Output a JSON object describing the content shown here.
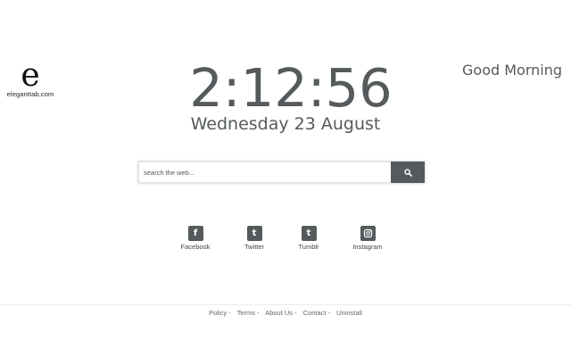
{
  "logo": {
    "mark": "e",
    "text": "eleganttab.com"
  },
  "greeting": "Good Morning",
  "clock": {
    "time": "2:12:56",
    "date": "Wednesday 23 August"
  },
  "search": {
    "placeholder": "search the web...",
    "button_icon": "search-icon"
  },
  "social": [
    {
      "label": "Facebook",
      "icon": "facebook-icon",
      "glyph": "f"
    },
    {
      "label": "Twitter",
      "icon": "twitter-icon",
      "glyph": "t"
    },
    {
      "label": "Tumblr",
      "icon": "tumblr-icon",
      "glyph": "t"
    },
    {
      "label": "Instagram",
      "icon": "instagram-icon",
      "glyph": ""
    }
  ],
  "footer": {
    "links": [
      "Policy",
      "Terms",
      "About Us",
      "Contact",
      "Uninstall"
    ],
    "separator": "-"
  },
  "colors": {
    "text": "#555a5c",
    "button": "#555a5c",
    "background": "#ffffff"
  }
}
